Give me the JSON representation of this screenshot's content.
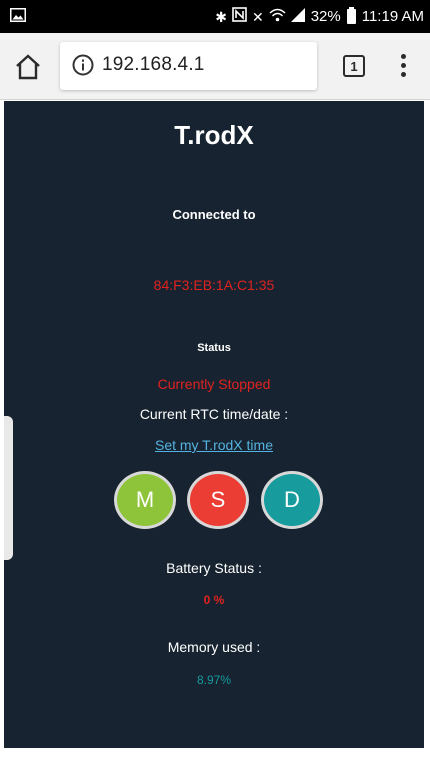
{
  "status_bar": {
    "battery_percent": "32%",
    "time": "11:19 AM"
  },
  "browser": {
    "url": "192.168.4.1",
    "tab_count": "1"
  },
  "page": {
    "title": "T.rodX",
    "connected_label": "Connected to",
    "mac_address": "84:F3:EB:1A:C1:35",
    "status_label": "Status",
    "status_value": "Currently Stopped",
    "rtc_label": "Current RTC time/date :",
    "set_time_link": "Set my T.rodX time",
    "mode_buttons": {
      "m": "M",
      "s": "S",
      "d": "D"
    },
    "battery_label": "Battery Status :",
    "battery_value": "0 %",
    "memory_label": "Memory used :",
    "memory_value": "8.97%"
  },
  "colors": {
    "page_background": "#172330",
    "alert_red": "#e0231f",
    "link_blue": "#54b3e0",
    "button_green": "#8dc43a",
    "button_red": "#ec3d34",
    "button_teal": "#179b9d"
  },
  "icons": {
    "status_left": "gallery-icon",
    "bluetooth": "bluetooth-icon",
    "nfc": "nfc-icon",
    "mute": "mute-icon",
    "wifi": "wifi-icon",
    "signal": "signal-icon",
    "battery": "battery-icon",
    "home": "home-icon",
    "info": "info-icon",
    "menu": "more-vertical-icon"
  }
}
